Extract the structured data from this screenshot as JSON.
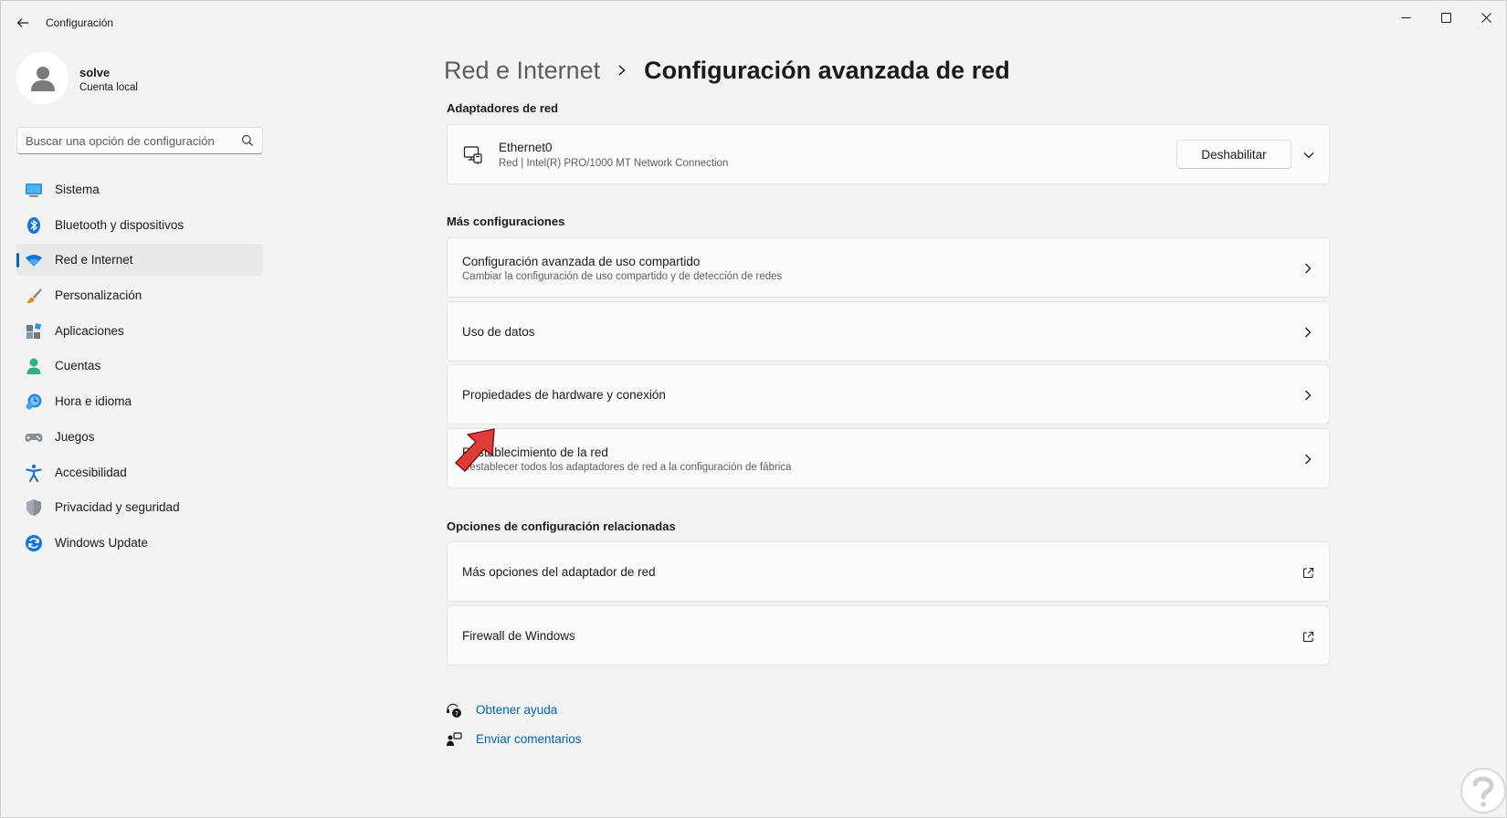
{
  "window": {
    "app_title": "Configuración"
  },
  "user": {
    "name": "solve",
    "account_type": "Cuenta local"
  },
  "search": {
    "placeholder": "Buscar una opción de configuración"
  },
  "sidebar": {
    "items": [
      {
        "label": "Sistema",
        "icon": "system-icon",
        "active": false
      },
      {
        "label": "Bluetooth y dispositivos",
        "icon": "bluetooth-icon",
        "active": false
      },
      {
        "label": "Red e Internet",
        "icon": "wifi-icon",
        "active": true
      },
      {
        "label": "Personalización",
        "icon": "brush-icon",
        "active": false
      },
      {
        "label": "Aplicaciones",
        "icon": "apps-icon",
        "active": false
      },
      {
        "label": "Cuentas",
        "icon": "accounts-icon",
        "active": false
      },
      {
        "label": "Hora e idioma",
        "icon": "time-language-icon",
        "active": false
      },
      {
        "label": "Juegos",
        "icon": "gamepad-icon",
        "active": false
      },
      {
        "label": "Accesibilidad",
        "icon": "accessibility-icon",
        "active": false
      },
      {
        "label": "Privacidad y seguridad",
        "icon": "shield-icon",
        "active": false
      },
      {
        "label": "Windows Update",
        "icon": "update-icon",
        "active": false
      }
    ]
  },
  "breadcrumb": {
    "parent": "Red e Internet",
    "current": "Configuración avanzada de red"
  },
  "adapters": {
    "section_title": "Adaptadores de red",
    "ethernet": {
      "name": "Ethernet0",
      "description": "Red | Intel(R) PRO/1000 MT Network Connection",
      "disable_label": "Deshabilitar"
    }
  },
  "more_settings": {
    "section_title": "Más configuraciones",
    "items": [
      {
        "title": "Configuración avanzada de uso compartido",
        "subtitle": "Cambiar la configuración de uso compartido y de detección de redes"
      },
      {
        "title": "Uso de datos",
        "subtitle": ""
      },
      {
        "title": "Propiedades de hardware y conexión",
        "subtitle": ""
      },
      {
        "title": "Restablecimiento de la red",
        "subtitle": "Restablecer todos los adaptadores de red a la configuración de fábrica"
      }
    ]
  },
  "related": {
    "section_title": "Opciones de configuración relacionadas",
    "items": [
      {
        "title": "Más opciones del adaptador de red"
      },
      {
        "title": "Firewall de Windows"
      }
    ]
  },
  "help_links": {
    "get_help": "Obtener ayuda",
    "send_feedback": "Enviar comentarios"
  },
  "colors": {
    "accent": "#0067c0",
    "link": "#0062b8",
    "annotation_arrow": "#e03c3c"
  }
}
